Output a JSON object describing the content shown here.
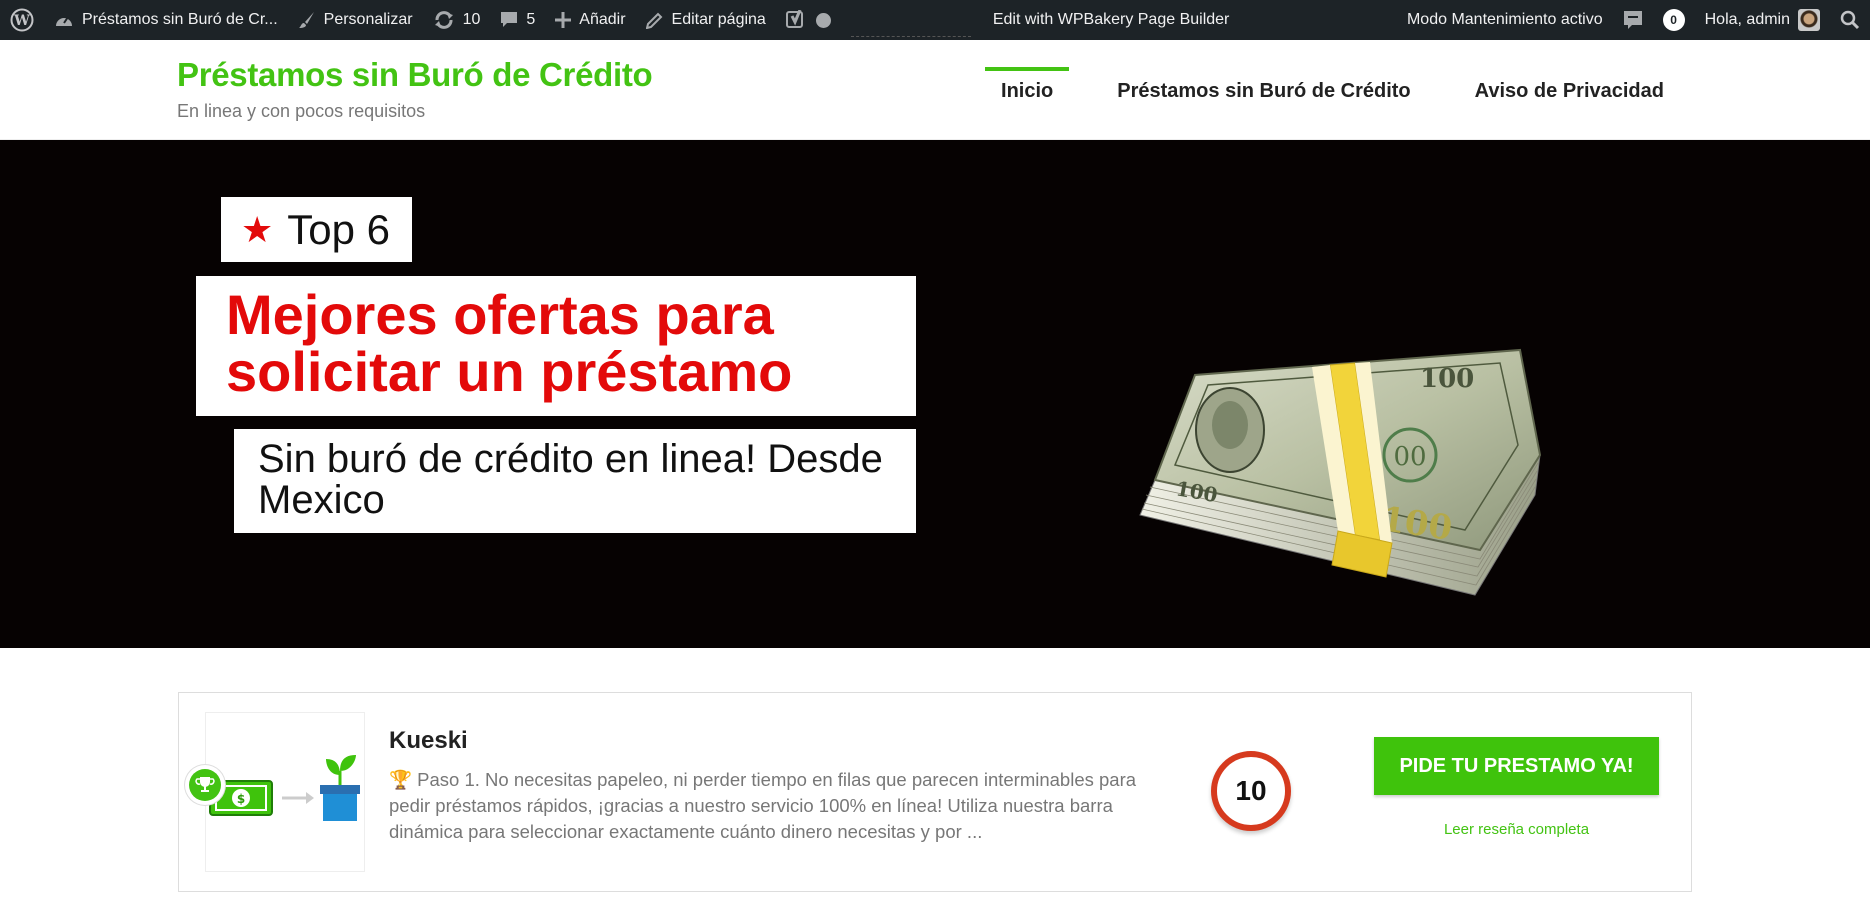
{
  "adminbar": {
    "site_name": "Préstamos sin Buró de Cr...",
    "customize": "Personalizar",
    "updates_count": "10",
    "comments_count": "5",
    "add_new": "Añadir",
    "edit_page": "Editar página",
    "wpbakery": "Edit with WPBakery Page Builder",
    "maintenance": "Modo Mantenimiento activo",
    "notif_count": "0",
    "greeting": "Hola, admin"
  },
  "header": {
    "site_title": "Préstamos sin Buró de Crédito",
    "tagline": "En linea y con pocos requisitos",
    "nav": [
      {
        "label": "Inicio",
        "active": true
      },
      {
        "label": "Préstamos sin Buró de Crédito",
        "active": false
      },
      {
        "label": "Aviso de Privacidad",
        "active": false
      }
    ]
  },
  "hero": {
    "badge_star": "★",
    "badge_text": "Top 6",
    "headline_line1": "Mejores ofertas para",
    "headline_line2": "solicitar un préstamo",
    "subheading_line1": "Sin buró de crédito en linea! Desde",
    "subheading_line2": "Mexico"
  },
  "listing": {
    "name": "Kueski",
    "description": "🏆 Paso 1. No necesitas papeleo, ni perder tiempo en filas que parecen interminables para pedir préstamos rápidos, ¡gracias a nuestro servicio 100% en línea! Utiliza nuestra barra dinámica para seleccionar exactamente cuánto dinero necesitas y por ...",
    "score": "10",
    "cta_label": "PIDE TU PRESTAMO YA!",
    "review_link": "Leer reseña completa"
  },
  "colors": {
    "brand_green": "#43c313",
    "headline_red": "#e30a0a",
    "adminbar_bg": "#1d2327",
    "score_ring": "#d63a1e"
  }
}
